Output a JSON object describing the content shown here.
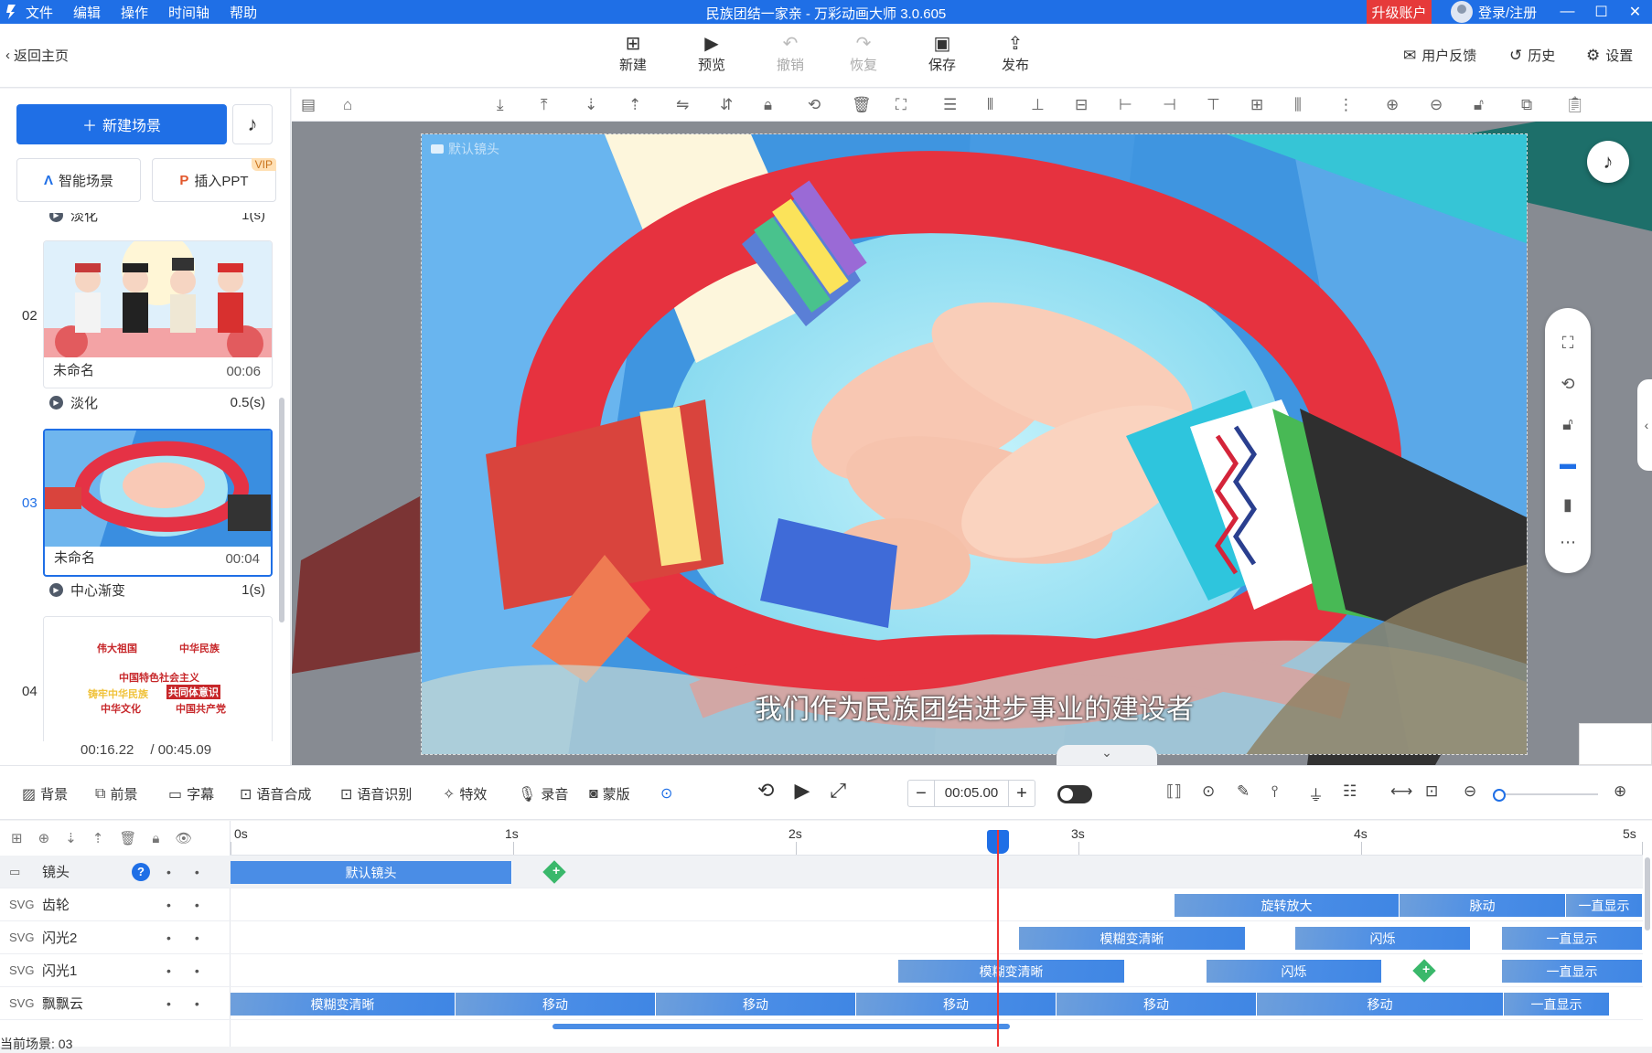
{
  "titlebar": {
    "menu": [
      "文件",
      "编辑",
      "操作",
      "时间轴",
      "帮助"
    ],
    "title": "民族团结一家亲 - 万彩动画大师 3.0.605",
    "upgrade": "升级账户",
    "login": "登录/注册"
  },
  "toolbar": {
    "back": "返回主页",
    "buttons": [
      {
        "label": "新建",
        "icon": "new-icon"
      },
      {
        "label": "预览",
        "icon": "play-icon"
      },
      {
        "label": "撤销",
        "icon": "undo-icon"
      },
      {
        "label": "恢复",
        "icon": "redo-icon"
      },
      {
        "label": "保存",
        "icon": "save-icon"
      },
      {
        "label": "发布",
        "icon": "publish-icon"
      }
    ],
    "feedback": "用户反馈",
    "history": "历史",
    "settings": "设置"
  },
  "left": {
    "new_scene": "新建场景",
    "smart_scene": "智能场景",
    "insert_ppt": "插入PPT",
    "vip": "VIP",
    "transitions": [
      {
        "name": "淡化",
        "dur": "1(s)"
      },
      {
        "name": "淡化",
        "dur": "0.5(s)"
      },
      {
        "name": "中心渐变",
        "dur": "1(s)"
      }
    ],
    "scenes": [
      {
        "num": "02",
        "name": "未命名",
        "time": "00:06"
      },
      {
        "num": "03",
        "name": "未命名",
        "time": "00:04"
      },
      {
        "num": "04",
        "name": "",
        "time": ""
      }
    ],
    "scene04_text": [
      "伟大祖国",
      "中华民族",
      "中国特色社会主义",
      "铸牢中华民族",
      "共同体意识",
      "中华文化",
      "中国共产党"
    ],
    "current_time": "00:16.22",
    "total_time": "/ 00:45.09"
  },
  "canvas": {
    "camera_label": "默认镜头",
    "subtitle": "我们作为民族团结进步事业的建设者"
  },
  "bottombar": {
    "tools": [
      "背景",
      "前景",
      "字幕",
      "语音合成",
      "语音识别",
      "特效",
      "录音",
      "蒙版"
    ],
    "time_value": "00:05.00"
  },
  "timeline": {
    "ticks": [
      "0s",
      "1s",
      "2s",
      "3s",
      "4s",
      "5s"
    ],
    "tracks": [
      {
        "name": "镜头",
        "clips": [
          {
            "label": "默认镜头"
          }
        ]
      },
      {
        "name": "齿轮",
        "clips": [
          {
            "label": "旋转放大"
          },
          {
            "label": "脉动"
          },
          {
            "label": "一直显示"
          }
        ]
      },
      {
        "name": "闪光2",
        "clips": [
          {
            "label": "模糊变清晰"
          },
          {
            "label": "闪烁"
          },
          {
            "label": "一直显示"
          }
        ]
      },
      {
        "name": "闪光1",
        "clips": [
          {
            "label": "模糊变清晰"
          },
          {
            "label": "闪烁"
          },
          {
            "label": "一直显示"
          }
        ]
      },
      {
        "name": "飘飘云",
        "clips": [
          {
            "label": "模糊变清晰"
          },
          {
            "label": "移动"
          },
          {
            "label": "移动"
          },
          {
            "label": "移动"
          },
          {
            "label": "移动"
          },
          {
            "label": "移动"
          },
          {
            "label": "一直显示"
          }
        ]
      }
    ],
    "status": "当前场景: 03"
  }
}
